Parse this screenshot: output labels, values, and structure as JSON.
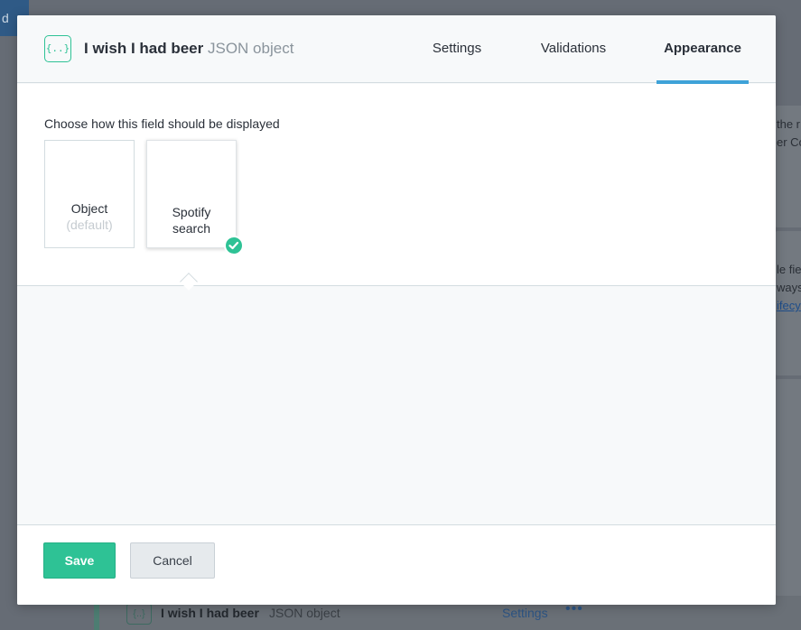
{
  "background": {
    "top_button_label": "d",
    "panel1_lines": [
      "the r",
      "er Co"
    ],
    "panel2_lines": [
      "le fie",
      "ways",
      "ifecy"
    ],
    "row": {
      "icon_label": "{..}",
      "title": "I wish I had beer",
      "type": "JSON object",
      "settings_label": "Settings",
      "more_label": "•••"
    }
  },
  "modal": {
    "header": {
      "icon_label": "{..}",
      "field_name": "I wish I had beer",
      "field_type": "JSON object",
      "tabs": [
        {
          "label": "Settings",
          "active": false
        },
        {
          "label": "Validations",
          "active": false
        },
        {
          "label": "Appearance",
          "active": true
        }
      ]
    },
    "appearance": {
      "prompt": "Choose how this field should be displayed",
      "options": [
        {
          "title": "Object",
          "subtitle": "(default)",
          "selected": false
        },
        {
          "title_line1": "Spotify",
          "title_line2": "search",
          "selected": true
        }
      ]
    },
    "footer": {
      "save_label": "Save",
      "cancel_label": "Cancel"
    }
  },
  "colors": {
    "accent_green": "#2ec295",
    "tab_active_underline": "#3ea2d8"
  }
}
